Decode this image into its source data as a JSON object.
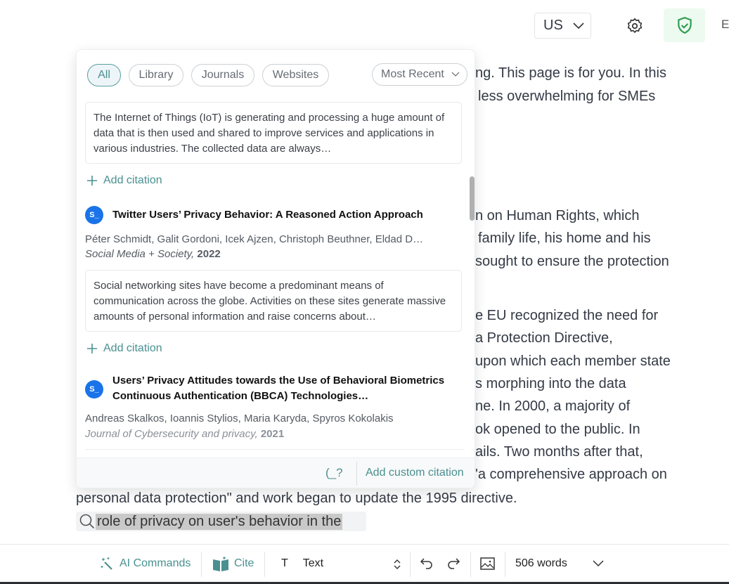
{
  "topbar": {
    "language": "US",
    "edge_letter": "E"
  },
  "document": {
    "lines": [
      "ng. This page is for you. In this",
      "less overwhelming for SMEs",
      "n on Human Rights, which",
      "family life, his home and his",
      "sought to ensure the protection",
      "e EU recognized the need for",
      "a Protection Directive,",
      "upon which each member state",
      "s morphing into the data",
      "ne. In 2000, a majority of",
      "ok opened to the public. In",
      "ails. Two months after that,",
      "'a comprehensive approach on",
      "personal data protection\" and work began to update the 1995 directive."
    ],
    "search_query": "role of privacy on user's behavior in the"
  },
  "popup": {
    "filters": [
      "All",
      "Library",
      "Journals",
      "Websites"
    ],
    "active_filter": "All",
    "sort": "Most Recent",
    "add_citation": "Add citation",
    "results": [
      {
        "abstract": "The Internet of Things (IoT) is generating and processing a huge amount of data that is then used and shared to improve services and applications in various industries. The collected data are always…"
      },
      {
        "logo": "S_",
        "title": "Twitter Users’ Privacy Behavior: A Reasoned Action Approach",
        "authors": "Péter Schmidt, Galit Gordoni, Icek Ajzen, Christoph Beuthner, Eldad D…",
        "journal": "Social Media + Society,",
        "year": "2022",
        "abstract": "Social networking sites have become a predominant means of communication across the globe. Activities on these sites generate massive amounts of personal information and raise concerns about…"
      },
      {
        "logo": "S_",
        "title": "Users’ Privacy Attitudes towards the Use of Behavioral Biometrics Continuous Authentication (BBCA) Technologies…",
        "authors": "Andreas Skalkos, Ioannis Stylios, Maria Karyda, Spyros Kokolakis",
        "journal": "Journal of Cybersecurity and privacy,",
        "year": "2021"
      }
    ],
    "footer": {
      "custom_icon_text": "(_?",
      "add_custom": "Add custom citation"
    }
  },
  "toolbar": {
    "ai_commands": "AI Commands",
    "cite": "Cite",
    "text_icon": "T",
    "text_style": "Text",
    "word_count": "506 words"
  },
  "colors": {
    "accent": "#4a9090",
    "shield": "#2e9e4f",
    "logo": "#1a73e8"
  }
}
